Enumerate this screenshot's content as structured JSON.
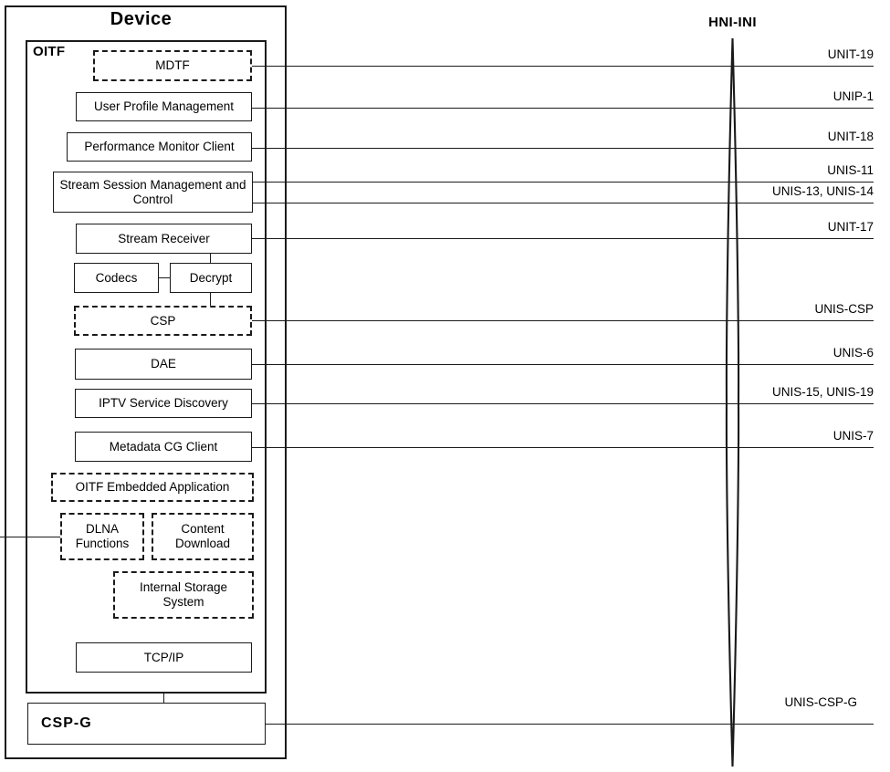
{
  "diagram": {
    "device_title": "Device",
    "oitf_title": "OITF",
    "hni_title": "HNI-INI"
  },
  "boxes": {
    "mdtf": "MDTF",
    "user_profile_management": "User Profile Management",
    "performance_monitor_client": "Performance Monitor Client",
    "stream_session_management": "Stream Session Management and Control",
    "stream_receiver": "Stream Receiver",
    "codecs": "Codecs",
    "decrypt": "Decrypt",
    "csp": "CSP",
    "dae": "DAE",
    "iptv_service_discovery": "IPTV Service Discovery",
    "metadata_cg_client": "Metadata CG Client",
    "oitf_embedded_application": "OITF Embedded Application",
    "dlna_functions": "DLNA Functions",
    "content_download": "Content Download",
    "internal_storage_system": "Internal Storage System",
    "tcp_ip": "TCP/IP",
    "csp_g": "CSP-G"
  },
  "interfaces": {
    "unit_19": "UNIT-19",
    "unip_1": "UNIP-1",
    "unit_18": "UNIT-18",
    "unis_11": "UNIS-11",
    "unis_13_14": "UNIS-13, UNIS-14",
    "unit_17": "UNIT-17",
    "unis_csp": "UNIS-CSP",
    "unis_6": "UNIS-6",
    "unis_15_19": "UNIS-15, UNIS-19",
    "unis_7": "UNIS-7",
    "unis_csp_g": "UNIS-CSP-G"
  },
  "colors": {
    "stroke": "#1a1a1a",
    "background": "#ffffff"
  }
}
